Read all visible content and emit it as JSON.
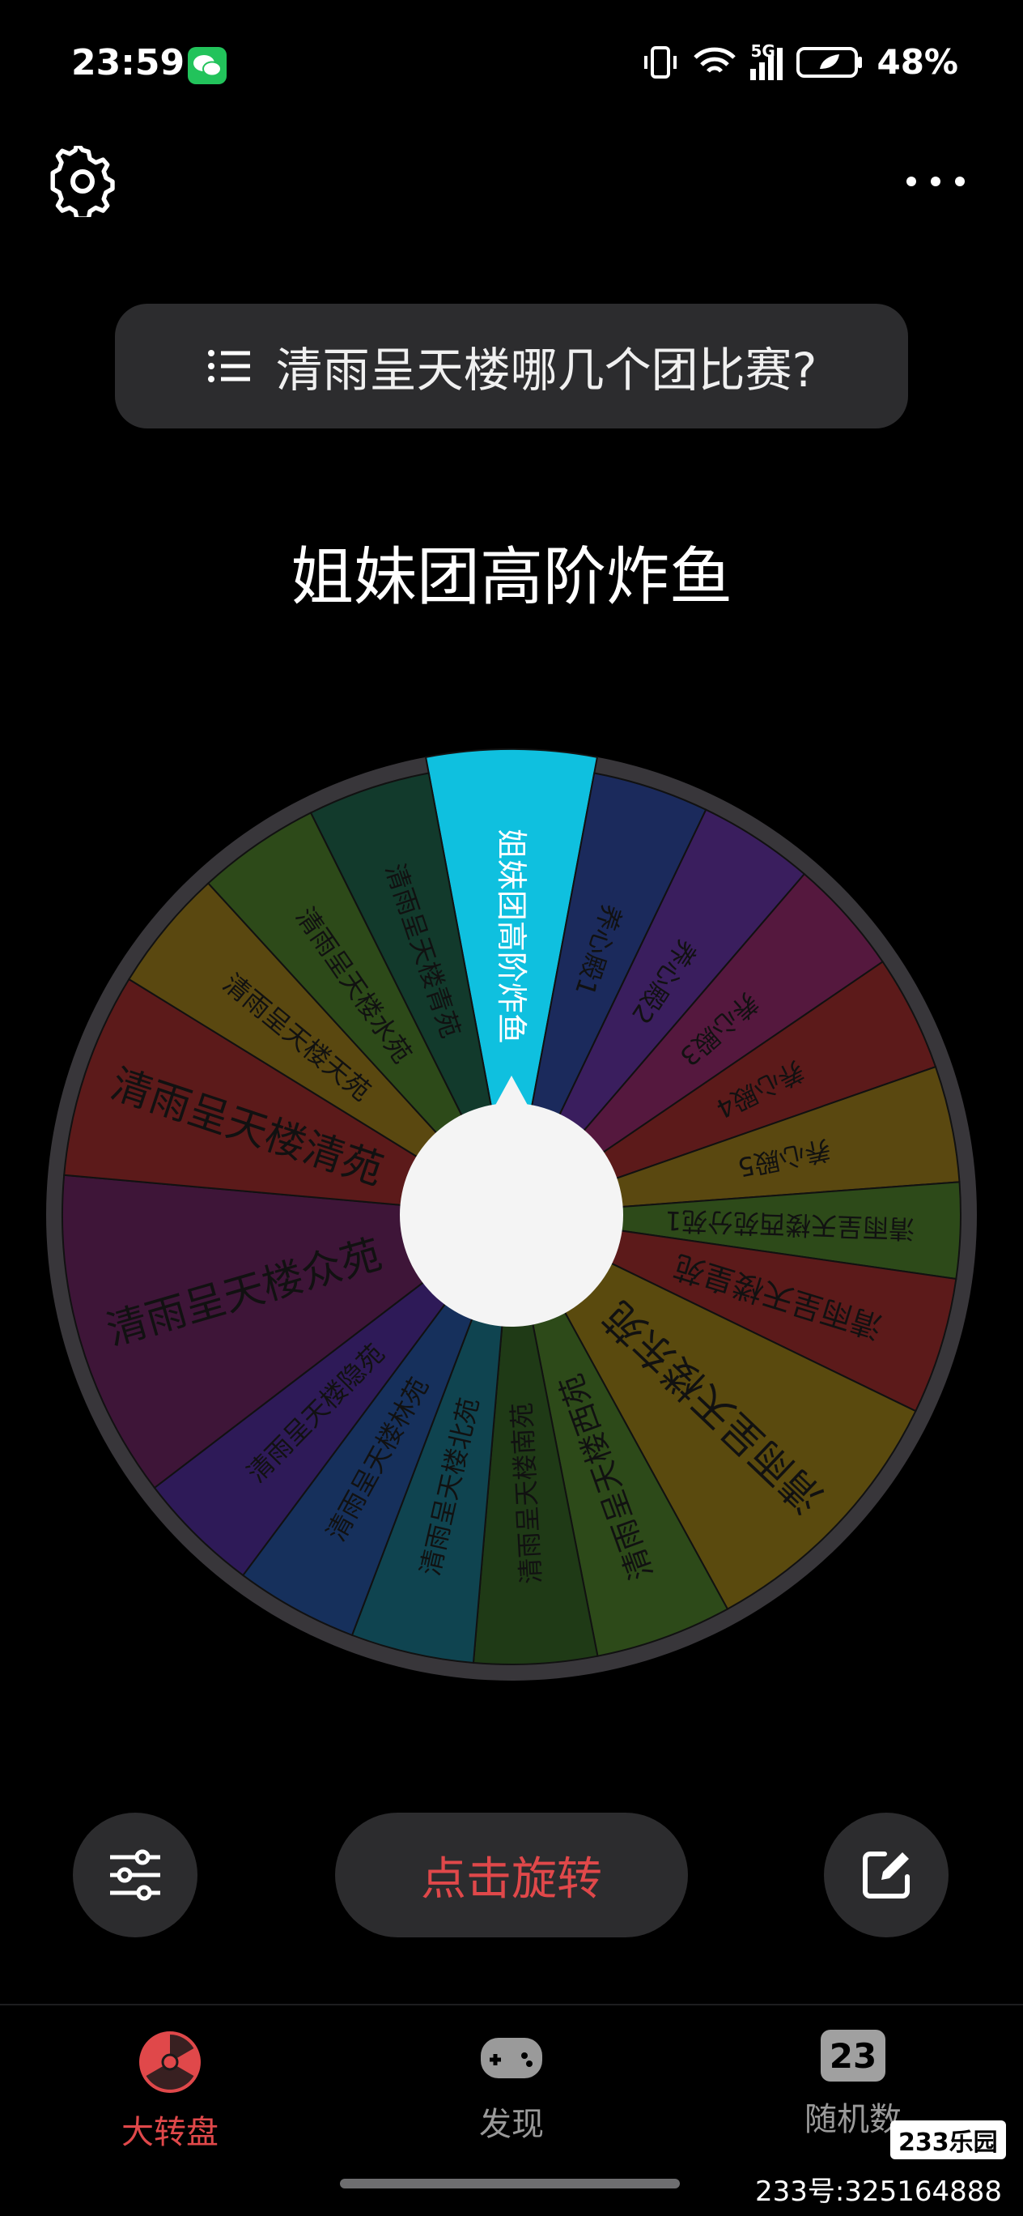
{
  "status_bar": {
    "time": "23:59",
    "battery": "48%",
    "network": "5G"
  },
  "question": {
    "text": "清雨呈天楼哪几个团比赛?"
  },
  "result": {
    "text": "姐妹团高阶炸鱼"
  },
  "wheel": {
    "segments": [
      {
        "label": "姐妹团高阶炸鱼",
        "color": "#0fc0df",
        "weight": 1.2,
        "text_color": "#ffffff"
      },
      {
        "label": "养心殿1",
        "color": "#1b2a5c",
        "weight": 0.85
      },
      {
        "label": "养心殿2",
        "color": "#3a1e5e",
        "weight": 0.85
      },
      {
        "label": "养心殿3",
        "color": "#55183e",
        "weight": 0.85
      },
      {
        "label": "养心殿4",
        "color": "#5c1a1a",
        "weight": 0.85
      },
      {
        "label": "养心殿5",
        "color": "#5a4810",
        "weight": 0.85
      },
      {
        "label": "清雨呈天楼西苑分苑1",
        "color": "#2d4a19",
        "weight": 0.7
      },
      {
        "label": "清雨呈天楼皇苑",
        "color": "#5c1a1a",
        "weight": 1.0
      },
      {
        "label": "清雨呈天楼东苑",
        "color": "#5a4a0e",
        "weight": 2.0
      },
      {
        "label": "清雨呈天楼西苑",
        "color": "#2d4a19",
        "weight": 1.0
      },
      {
        "label": "清雨呈天楼南苑",
        "color": "#1f3a16",
        "weight": 0.9
      },
      {
        "label": "清雨呈天楼北苑",
        "color": "#0f4450",
        "weight": 0.9
      },
      {
        "label": "清雨呈天楼林苑",
        "color": "#16305c",
        "weight": 0.9
      },
      {
        "label": "清雨呈天楼隐苑",
        "color": "#2e1a58",
        "weight": 0.9
      },
      {
        "label": "清雨呈天楼众苑",
        "color": "#3e1538",
        "weight": 2.4
      },
      {
        "label": "清雨呈天楼清苑",
        "color": "#5c1a1a",
        "weight": 1.5
      },
      {
        "label": "清雨呈天楼天苑",
        "color": "#5a4810",
        "weight": 0.9
      },
      {
        "label": "清雨呈天楼水苑",
        "color": "#2d4a19",
        "weight": 0.9
      },
      {
        "label": "清雨呈天楼青苑",
        "color": "#123a2c",
        "weight": 0.9
      }
    ],
    "rim_color": "#38363a",
    "hub_color": "#f4f4f4"
  },
  "controls": {
    "spin_label": "点击旋转"
  },
  "tabs": [
    {
      "label": "大转盘",
      "icon": "radiation-wheel-icon",
      "active": true
    },
    {
      "label": "发现",
      "icon": "gamepad-icon",
      "active": false
    },
    {
      "label": "随机数",
      "icon": "number-23-icon",
      "active": false,
      "icon_text": "23"
    }
  ],
  "watermark": {
    "logo": "233乐园",
    "id_text": "233号:325164888"
  },
  "colors": {
    "accent": "#e0484a",
    "background": "#000000",
    "pill": "#2c2c2e"
  }
}
